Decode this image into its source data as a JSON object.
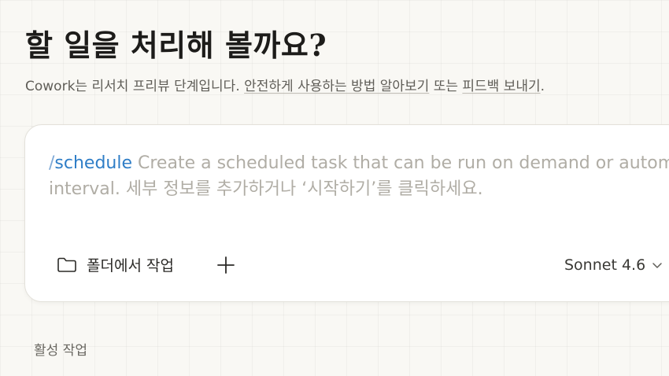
{
  "header": {
    "title": "할 일을 처리해 볼까요?"
  },
  "subtitle": {
    "product": "Cowork",
    "text_before": "는 리서치 프리뷰 단계입니다. ",
    "link_learn": "안전하게 사용하는 방법 알아보기",
    "text_between": " 또는 ",
    "link_feedback": "피드백 보내기",
    "text_after": "."
  },
  "composer": {
    "command_slash": "/",
    "command_name": "schedule",
    "prompt_line1": " Create a scheduled task that can be run on demand or automatically on an",
    "prompt_line2": "interval. 세부 정보를 추가하거나 ‘시작하기’를 클릭하세요.",
    "folder_button_label": "폴더에서 작업",
    "folder_icon": "folder-icon",
    "add_icon": "plus-icon",
    "model_label": "Sonnet 4.6",
    "model_dropdown_icon": "chevron-down-icon"
  },
  "sections": {
    "active_tasks_label": "활성 작업"
  },
  "colors": {
    "background": "#f9f8f4",
    "card": "#ffffff",
    "command_accent": "#2f7ec7",
    "placeholder": "#b0ada5"
  }
}
